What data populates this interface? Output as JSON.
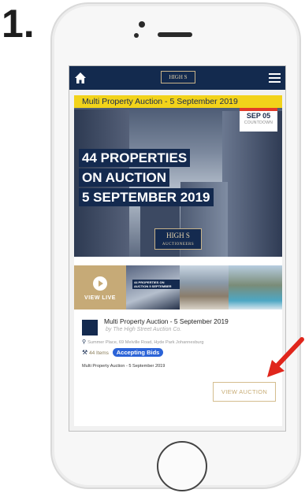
{
  "step_number": "1.",
  "nav": {
    "logo_text": "HIGH S",
    "home_icon": "home-icon",
    "menu_icon": "menu-icon"
  },
  "banner": {
    "title": "Multi Property Auction - 5 September 2019",
    "date": "SEP 05",
    "date_caption": "COUNTDOWN",
    "headline": [
      "44 PROPERTIES",
      "ON AUCTION",
      "5 SEPTEMBER 2019"
    ],
    "brand_name": "HIGH S",
    "brand_sub": "AUCTIONEERS",
    "slides": 5,
    "active_slide": 1
  },
  "thumbnails": {
    "live_label": "VIEW LIVE",
    "mini_text": "44 PROPERTIES ON AUCTION 5 SEPTEMBER"
  },
  "auction": {
    "title": "Multi Property Auction - 5 September 2019",
    "by_line": "by The High Street Auction Co.",
    "address": "Summer Place, 69 Melville Road, Hyde Park Johannesburg",
    "lots": "44 Items",
    "status": "Accepting Bids",
    "description": "Multi Property Auction - 5 September 2019",
    "view_button": "VIEW AUCTION"
  },
  "colors": {
    "navy": "#132a4e",
    "gold": "#c6aa77",
    "yellow_strip": "#f2d31a",
    "badge_blue": "#2b63d7",
    "arrow_red": "#e0261c"
  }
}
